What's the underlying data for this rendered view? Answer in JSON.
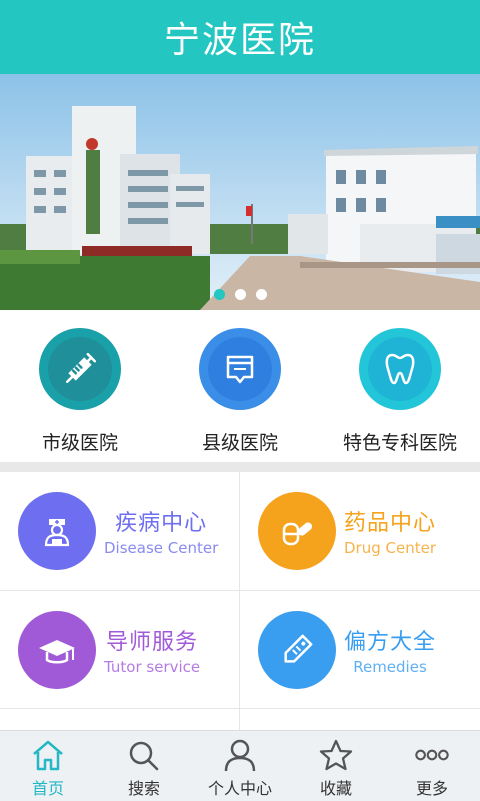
{
  "header": {
    "title": "宁波医院"
  },
  "banner": {
    "slide_count": 3,
    "active_slide": 1
  },
  "quick_links": [
    {
      "label": "市级医院",
      "icon": "syringe-icon",
      "ring": "#1aa0a8",
      "fill": "#1f8f9a"
    },
    {
      "label": "县级医院",
      "icon": "ticket-icon",
      "ring": "#3a8ee8",
      "fill": "#2f7fe0"
    },
    {
      "label": "特色专科医院",
      "icon": "tooth-icon",
      "ring": "#23c6d8",
      "fill": "#1fb4d6"
    }
  ],
  "services": [
    {
      "cn": "疾病中心",
      "en": "Disease Center",
      "color": "#6e6ef0",
      "icon": "doctor-icon"
    },
    {
      "cn": "药品中心",
      "en": "Drug Center",
      "color": "#f5a21c",
      "icon": "pill-icon"
    },
    {
      "cn": "导师服务",
      "en": "Tutor service",
      "color": "#a05ad8",
      "icon": "graduation-cap-icon"
    },
    {
      "cn": "偏方大全",
      "en": "Remedies",
      "color": "#3a9ef0",
      "icon": "tag-icon"
    }
  ],
  "tabbar": [
    {
      "label": "首页",
      "icon": "home-icon",
      "active": true
    },
    {
      "label": "搜索",
      "icon": "search-icon",
      "active": false
    },
    {
      "label": "个人中心",
      "icon": "user-icon",
      "active": false
    },
    {
      "label": "收藏",
      "icon": "star-icon",
      "active": false
    },
    {
      "label": "更多",
      "icon": "more-icon",
      "active": false
    }
  ],
  "colors": {
    "accent": "#23c6c0",
    "tab_active": "#23b8c4"
  }
}
